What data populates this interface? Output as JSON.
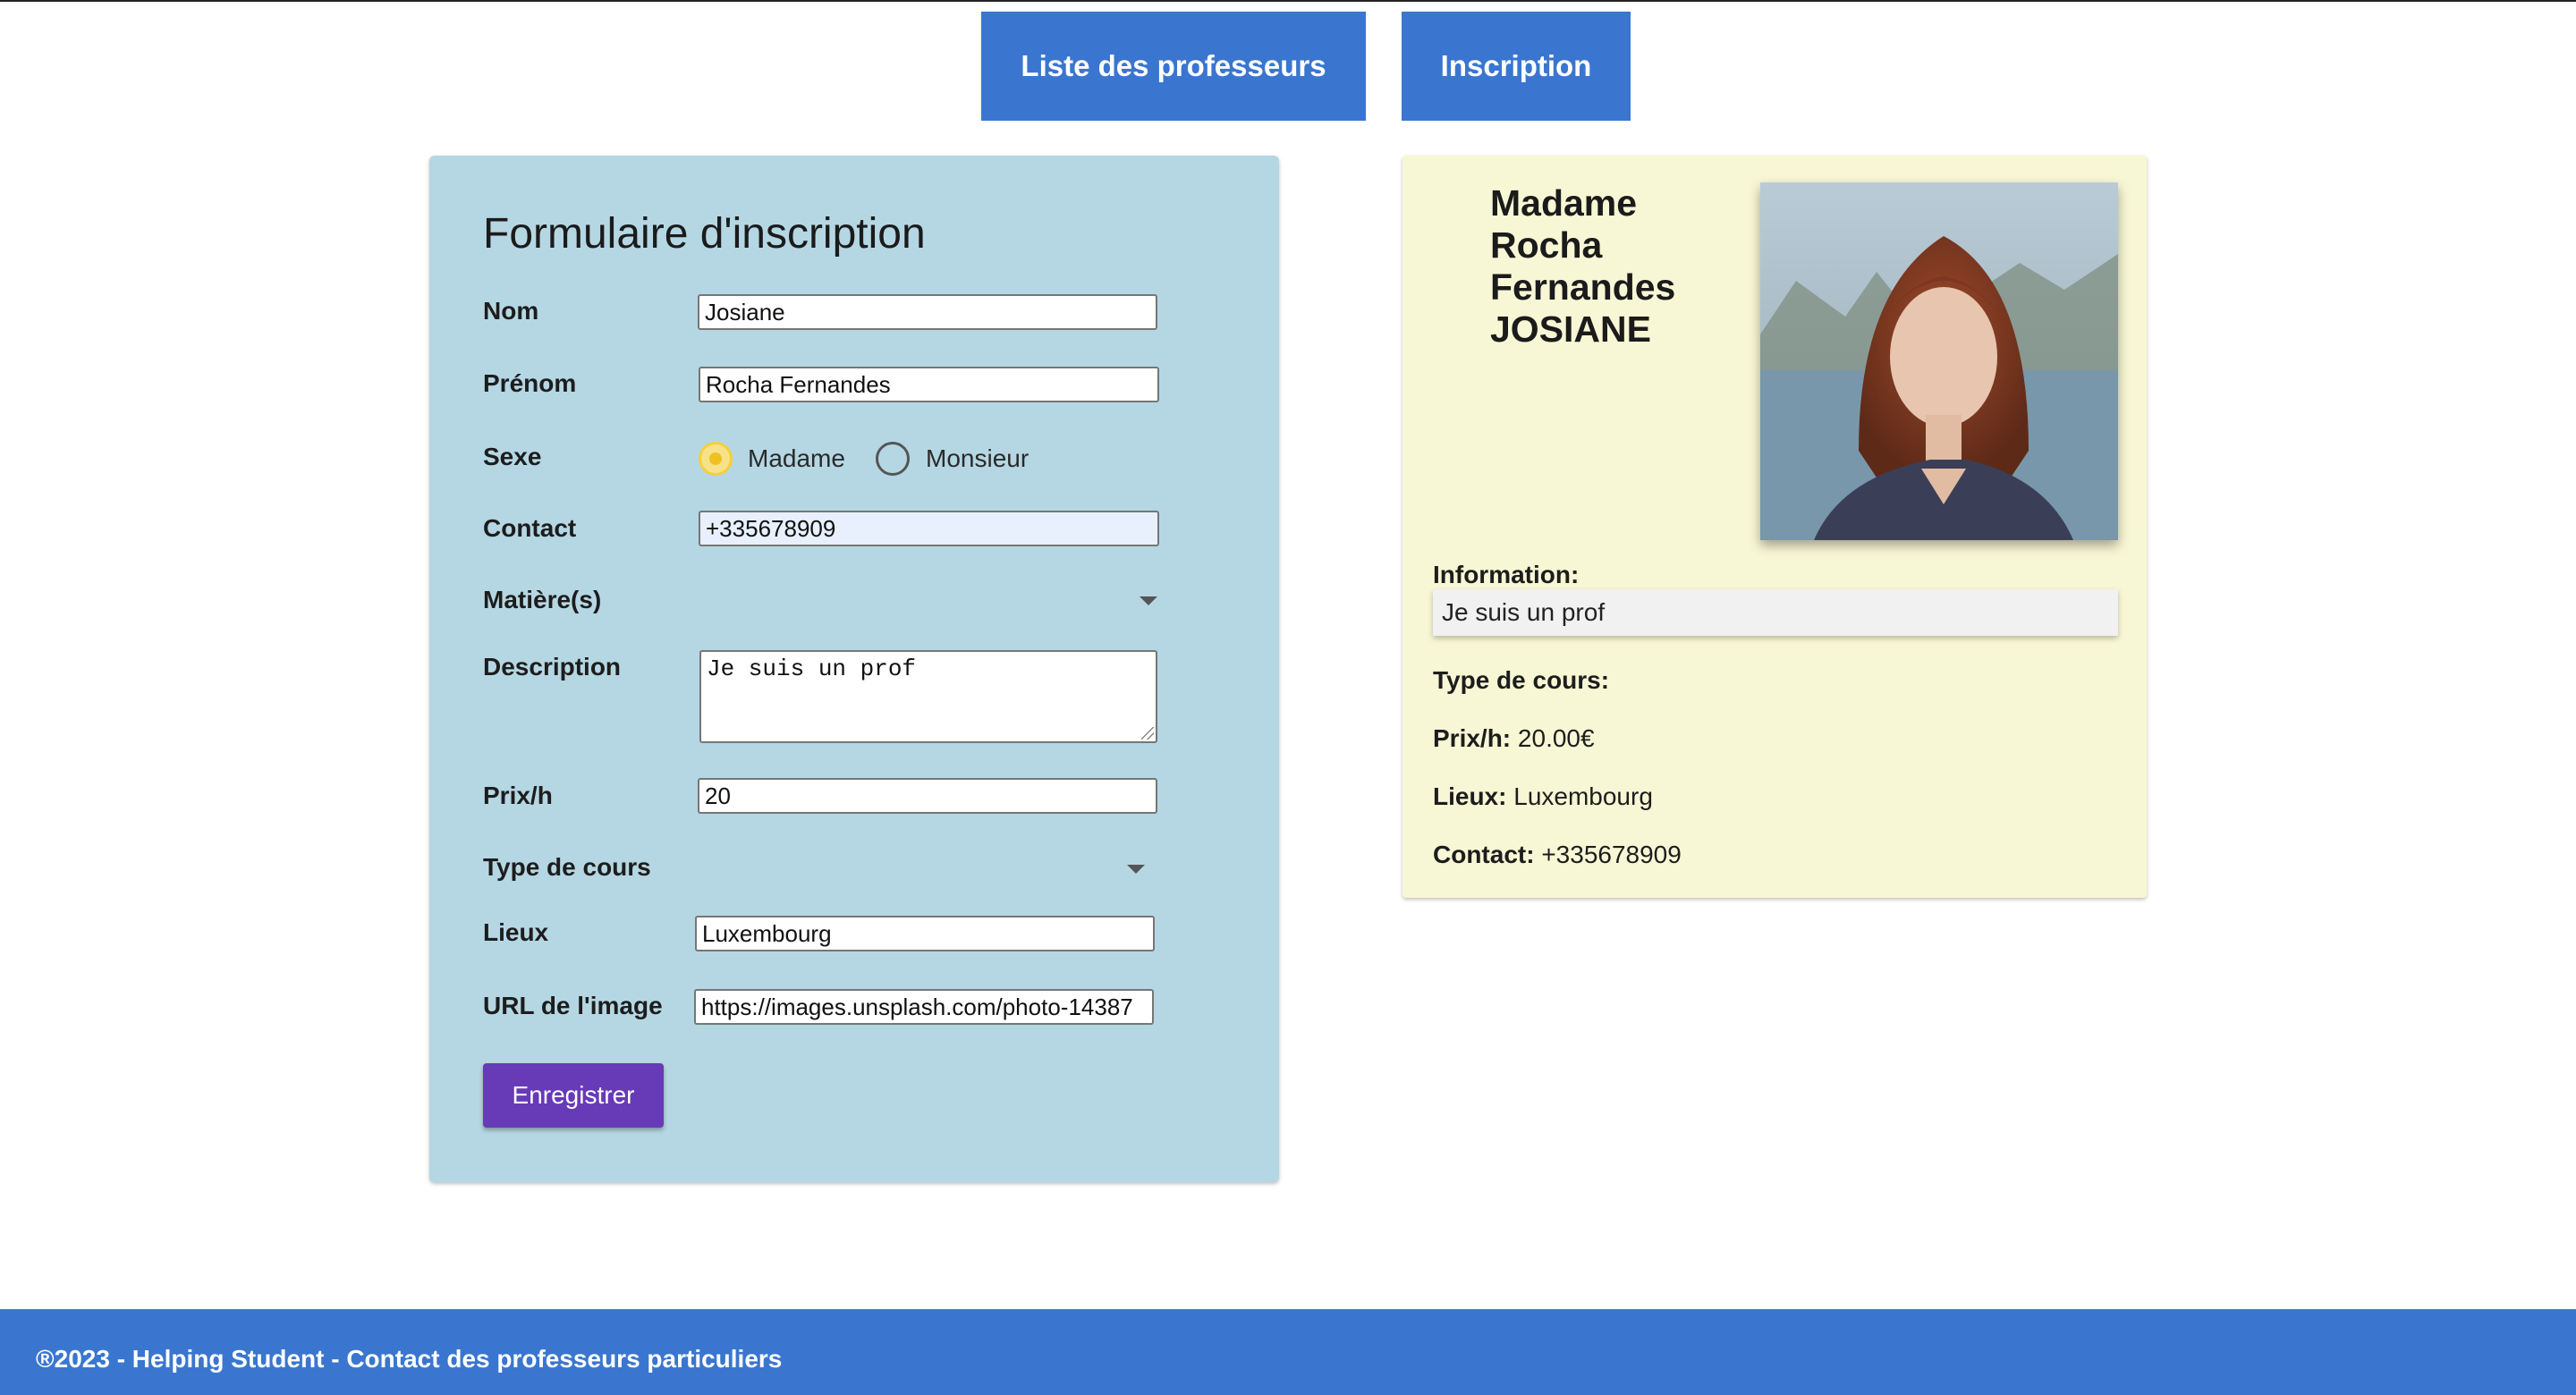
{
  "nav": {
    "list_label": "Liste des professeurs",
    "signup_label": "Inscription"
  },
  "form": {
    "title": "Formulaire d'inscription",
    "nom_label": "Nom",
    "nom_value": "Josiane",
    "prenom_label": "Prénom",
    "prenom_value": "Rocha Fernandes",
    "sexe_label": "Sexe",
    "sexe_options": [
      "Madame",
      "Monsieur"
    ],
    "sexe_selected": "Madame",
    "contact_label": "Contact",
    "contact_value": "+335678909",
    "matieres_label": "Matière(s)",
    "description_label": "Description",
    "description_value": "Je suis un prof",
    "prix_label": "Prix/h",
    "prix_value": "20",
    "type_cours_label": "Type de cours",
    "lieux_label": "Lieux",
    "lieux_value": "Luxembourg",
    "image_url_label": "URL de l'image",
    "image_url_value": "https://images.unsplash.com/photo-14387",
    "submit_label": "Enregistrer"
  },
  "preview": {
    "name_line1": "Madame Rocha",
    "name_line2": "Fernandes",
    "name_line3": "JOSIANE",
    "information_label": "Information:",
    "information_value": "Je suis un prof",
    "type_cours_label": "Type de cours:",
    "prix_label": "Prix/h:",
    "prix_value": "20.00€",
    "lieux_label": "Lieux:",
    "lieux_value": "Luxembourg",
    "contact_label": "Contact:",
    "contact_value": "+335678909"
  },
  "footer": {
    "text": "®2023 - Helping Student - Contact des professeurs particuliers"
  },
  "colors": {
    "nav_bg": "#3a76cf",
    "form_bg": "#b5d7e3",
    "preview_bg": "#f8f7d5",
    "submit_bg": "#673ab7",
    "radio_checked": "#f5cf3a",
    "footer_bg": "#3a76cf"
  }
}
